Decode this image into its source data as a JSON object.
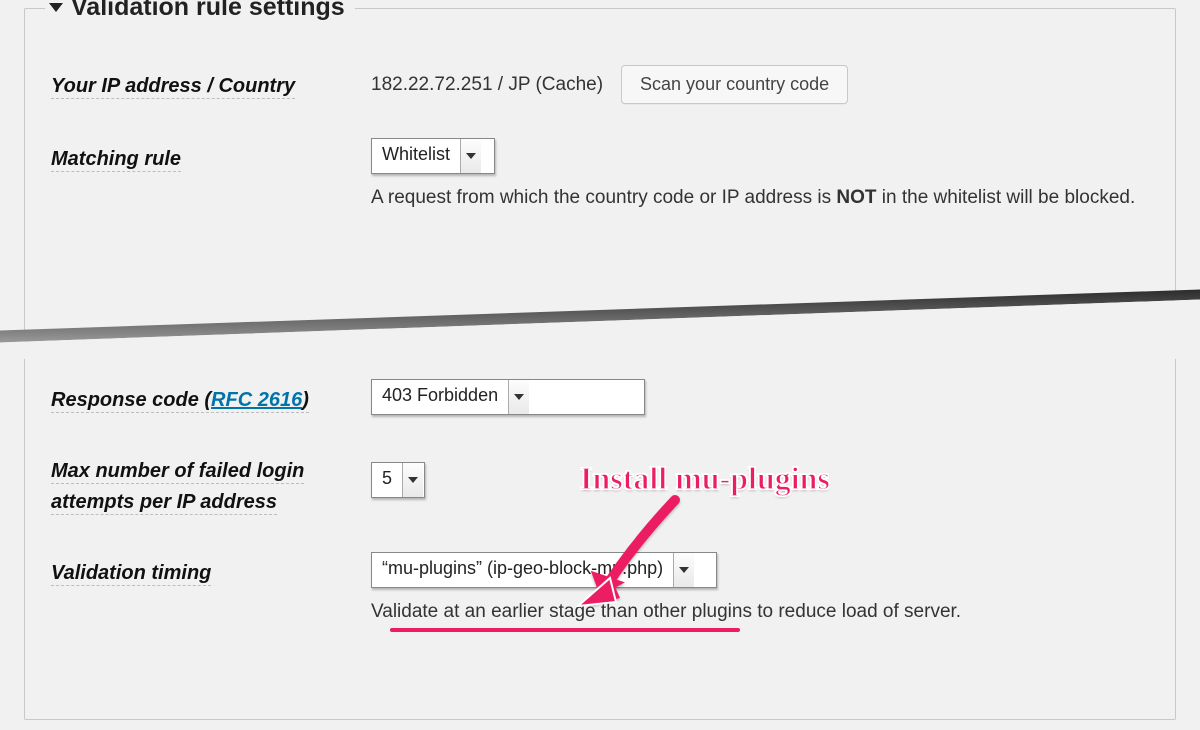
{
  "legend": "Validation rule settings",
  "rows": {
    "ip": {
      "label": "Your IP address / Country",
      "value": "182.22.72.251 / JP (Cache)",
      "button": "Scan your country code"
    },
    "matching": {
      "label": "Matching rule",
      "select": "Whitelist",
      "desc_pre": "A request from which the country code or IP address is ",
      "desc_bold": "NOT",
      "desc_post": " in the whitelist will be blocked."
    },
    "response": {
      "label_pre": "Response code",
      "rfc_text": "RFC 2616",
      "select": "403 Forbidden"
    },
    "maxfail": {
      "label": "Max number of failed login attempts per IP address",
      "select": "5"
    },
    "timing": {
      "label": "Validation timing",
      "select": "“mu-plugins” (ip-geo-block-mu.php)",
      "desc": "Validate at an earlier stage than other plugins to reduce load of server."
    }
  },
  "annotation": "Install mu-plugins"
}
